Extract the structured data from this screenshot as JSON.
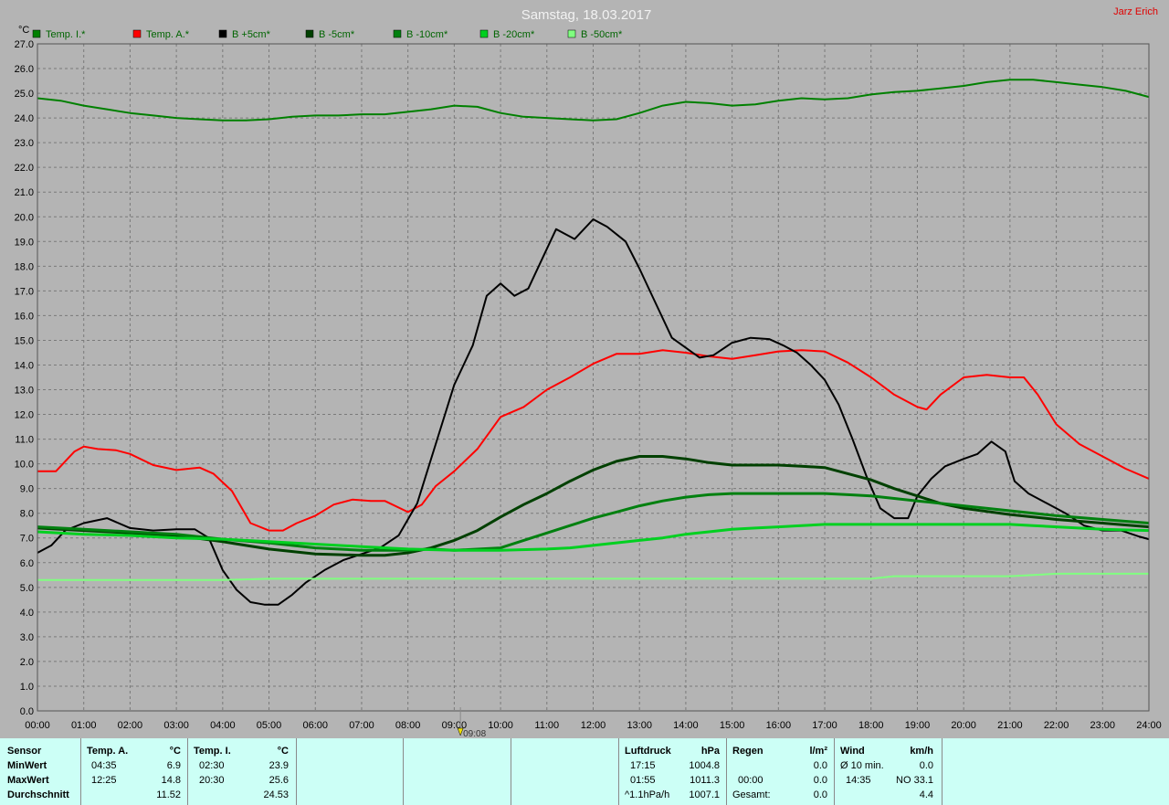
{
  "title": "Samstag, 18.03.2017",
  "author": "Jarz Erich",
  "y_unit": "°C",
  "current_time": "09:08",
  "colors": {
    "background": "#b4b4b4",
    "grid": "#7a7a7a",
    "title": "#f2f2f2",
    "author": "#e00000",
    "legend_text": "#006400",
    "panel": "#ccfff6"
  },
  "chart_data": {
    "type": "line",
    "title": "Samstag, 18.03.2017",
    "ylabel": "°C",
    "ylim": [
      0,
      27
    ],
    "xlim": [
      0,
      24
    ],
    "grid": true,
    "legend_position": "top",
    "x_ticks": [
      "00:00",
      "01:00",
      "02:00",
      "03:00",
      "04:00",
      "05:00",
      "06:00",
      "07:00",
      "08:00",
      "09:00",
      "10:00",
      "11:00",
      "12:00",
      "13:00",
      "14:00",
      "15:00",
      "16:00",
      "17:00",
      "18:00",
      "19:00",
      "20:00",
      "21:00",
      "22:00",
      "23:00",
      "24:00"
    ],
    "y_ticks": [
      "0.0",
      "1.0",
      "2.0",
      "3.0",
      "4.0",
      "5.0",
      "6.0",
      "7.0",
      "8.0",
      "9.0",
      "10.0",
      "11.0",
      "12.0",
      "13.0",
      "14.0",
      "15.0",
      "16.0",
      "17.0",
      "18.0",
      "19.0",
      "20.0",
      "21.0",
      "22.0",
      "23.0",
      "24.0",
      "25.0",
      "26.0",
      "27.0"
    ],
    "series": [
      {
        "name": "Temp. I.*",
        "color": "#008000",
        "width": 2,
        "x": [
          0,
          0.5,
          1,
          1.5,
          2,
          2.5,
          3,
          3.5,
          4,
          4.5,
          5,
          5.5,
          6,
          6.5,
          7,
          7.5,
          8,
          8.5,
          9,
          9.5,
          10,
          10.5,
          11,
          11.5,
          12,
          12.5,
          13,
          13.5,
          14,
          14.5,
          15,
          15.5,
          16,
          16.5,
          17,
          17.5,
          18,
          18.5,
          19,
          19.5,
          20,
          20.5,
          21,
          21.5,
          22,
          22.5,
          23,
          23.5,
          24
        ],
        "y": [
          24.8,
          24.7,
          24.5,
          24.35,
          24.2,
          24.1,
          24.0,
          23.95,
          23.9,
          23.9,
          23.95,
          24.05,
          24.1,
          24.1,
          24.15,
          24.15,
          24.25,
          24.35,
          24.5,
          24.45,
          24.2,
          24.05,
          24.0,
          23.95,
          23.9,
          23.95,
          24.2,
          24.5,
          24.65,
          24.6,
          24.5,
          24.55,
          24.7,
          24.8,
          24.75,
          24.8,
          24.95,
          25.05,
          25.1,
          25.2,
          25.3,
          25.45,
          25.55,
          25.55,
          25.45,
          25.35,
          25.25,
          25.1,
          24.85
        ]
      },
      {
        "name": "Temp. A.*",
        "color": "#ff0000",
        "width": 2,
        "x": [
          0,
          0.4,
          0.8,
          1.0,
          1.3,
          1.7,
          2.0,
          2.5,
          3.0,
          3.5,
          3.8,
          4.2,
          4.6,
          5.0,
          5.3,
          5.6,
          6.0,
          6.4,
          6.8,
          7.2,
          7.5,
          8.0,
          8.3,
          8.6,
          9.0,
          9.5,
          10.0,
          10.5,
          11.0,
          11.5,
          12.0,
          12.5,
          13.0,
          13.5,
          14.0,
          14.5,
          15.0,
          15.5,
          16.0,
          16.5,
          17.0,
          17.5,
          18.0,
          18.5,
          19.0,
          19.2,
          19.5,
          20.0,
          20.5,
          21.0,
          21.3,
          21.6,
          22.0,
          22.5,
          23.0,
          23.5,
          24.0
        ],
        "y": [
          9.7,
          9.7,
          10.5,
          10.7,
          10.6,
          10.55,
          10.4,
          9.95,
          9.75,
          9.85,
          9.6,
          8.9,
          7.6,
          7.3,
          7.3,
          7.6,
          7.9,
          8.35,
          8.55,
          8.5,
          8.5,
          8.05,
          8.35,
          9.1,
          9.7,
          10.6,
          11.9,
          12.3,
          13.0,
          13.5,
          14.05,
          14.45,
          14.45,
          14.6,
          14.5,
          14.35,
          14.25,
          14.4,
          14.55,
          14.6,
          14.55,
          14.1,
          13.5,
          12.8,
          12.3,
          12.2,
          12.8,
          13.5,
          13.6,
          13.5,
          13.5,
          12.8,
          11.6,
          10.8,
          10.3,
          9.8,
          9.4
        ]
      },
      {
        "name": "B +5cm*",
        "color": "#000000",
        "width": 2,
        "x": [
          0,
          0.3,
          0.6,
          1.0,
          1.5,
          2.0,
          2.5,
          3.0,
          3.4,
          3.7,
          4.0,
          4.3,
          4.6,
          4.9,
          5.2,
          5.5,
          5.8,
          6.2,
          6.6,
          7.0,
          7.4,
          7.8,
          8.2,
          8.6,
          9.0,
          9.4,
          9.7,
          10.0,
          10.3,
          10.6,
          10.9,
          11.2,
          11.6,
          12.0,
          12.3,
          12.7,
          13.0,
          13.3,
          13.7,
          14.0,
          14.3,
          14.6,
          15.0,
          15.4,
          15.8,
          16.1,
          16.4,
          16.7,
          17.0,
          17.3,
          17.6,
          17.9,
          18.2,
          18.5,
          18.8,
          19.0,
          19.3,
          19.6,
          20.0,
          20.3,
          20.6,
          20.9,
          21.1,
          21.4,
          21.8,
          22.2,
          22.6,
          23.0,
          23.4,
          23.8,
          24.0
        ],
        "y": [
          6.4,
          6.7,
          7.3,
          7.6,
          7.8,
          7.4,
          7.3,
          7.35,
          7.35,
          7.0,
          5.7,
          4.9,
          4.4,
          4.3,
          4.3,
          4.7,
          5.2,
          5.7,
          6.1,
          6.35,
          6.6,
          7.1,
          8.4,
          10.8,
          13.2,
          14.8,
          16.8,
          17.3,
          16.8,
          17.1,
          18.3,
          19.5,
          19.1,
          19.9,
          19.6,
          19.0,
          17.9,
          16.7,
          15.1,
          14.7,
          14.3,
          14.4,
          14.9,
          15.1,
          15.05,
          14.8,
          14.5,
          14.0,
          13.4,
          12.4,
          11.0,
          9.5,
          8.2,
          7.8,
          7.8,
          8.7,
          9.4,
          9.9,
          10.2,
          10.4,
          10.9,
          10.5,
          9.3,
          8.8,
          8.4,
          8.0,
          7.5,
          7.3,
          7.3,
          7.05,
          6.95
        ]
      },
      {
        "name": "B -5cm*",
        "color": "#004000",
        "width": 3,
        "x": [
          0,
          1,
          2,
          3,
          4,
          5,
          6,
          7,
          7.5,
          8,
          8.5,
          9,
          9.5,
          10,
          10.5,
          11,
          11.5,
          12,
          12.5,
          13,
          13.5,
          14,
          14.5,
          15,
          15.5,
          16,
          16.5,
          17,
          17.5,
          18,
          18.5,
          19,
          19.5,
          20,
          21,
          22,
          23,
          24
        ],
        "y": [
          7.4,
          7.3,
          7.2,
          7.1,
          6.85,
          6.55,
          6.35,
          6.3,
          6.3,
          6.4,
          6.6,
          6.9,
          7.3,
          7.85,
          8.35,
          8.8,
          9.3,
          9.75,
          10.1,
          10.3,
          10.3,
          10.2,
          10.05,
          9.95,
          9.95,
          9.95,
          9.9,
          9.85,
          9.6,
          9.35,
          9.0,
          8.7,
          8.4,
          8.2,
          7.95,
          7.75,
          7.6,
          7.45
        ]
      },
      {
        "name": "B -10cm*",
        "color": "#00800f",
        "width": 3,
        "x": [
          0,
          1,
          2,
          3,
          4,
          5,
          6,
          7,
          8,
          8.5,
          9,
          10,
          10.5,
          11,
          11.5,
          12,
          12.5,
          13,
          13.5,
          14,
          14.5,
          15,
          15.5,
          16,
          17,
          17.5,
          18,
          18.5,
          19,
          19.5,
          20,
          21,
          22,
          23,
          24
        ],
        "y": [
          7.45,
          7.35,
          7.25,
          7.15,
          6.95,
          6.8,
          6.6,
          6.5,
          6.5,
          6.55,
          6.5,
          6.6,
          6.9,
          7.2,
          7.5,
          7.8,
          8.05,
          8.3,
          8.5,
          8.65,
          8.75,
          8.8,
          8.8,
          8.8,
          8.8,
          8.75,
          8.7,
          8.6,
          8.5,
          8.4,
          8.3,
          8.1,
          7.9,
          7.75,
          7.6
        ]
      },
      {
        "name": "B -20cm*",
        "color": "#00d020",
        "width": 3,
        "x": [
          0,
          1,
          2,
          3,
          4,
          5,
          6,
          7,
          8,
          9,
          10,
          11,
          11.5,
          12,
          12.5,
          13,
          13.5,
          14,
          14.5,
          15,
          15.5,
          16,
          16.5,
          17,
          18,
          19,
          20,
          21,
          21.5,
          22,
          23,
          24
        ],
        "y": [
          7.25,
          7.15,
          7.1,
          7.0,
          6.95,
          6.85,
          6.75,
          6.65,
          6.55,
          6.5,
          6.5,
          6.55,
          6.6,
          6.7,
          6.8,
          6.9,
          7.0,
          7.15,
          7.25,
          7.35,
          7.4,
          7.45,
          7.5,
          7.55,
          7.55,
          7.55,
          7.55,
          7.55,
          7.5,
          7.45,
          7.35,
          7.3
        ]
      },
      {
        "name": "B -50cm*",
        "color": "#80ff80",
        "width": 2,
        "x": [
          0,
          4,
          5,
          18,
          18.5,
          19,
          21,
          22,
          23,
          24
        ],
        "y": [
          5.3,
          5.3,
          5.35,
          5.35,
          5.45,
          5.45,
          5.45,
          5.55,
          5.55,
          5.55
        ]
      }
    ]
  },
  "stats": {
    "sensor_label": "Sensor",
    "min_label": "MinWert",
    "max_label": "MaxWert",
    "avg_label": "Durchschnitt",
    "temp_a": {
      "title": "Temp. A.",
      "unit": "°C",
      "min_time": "04:35",
      "min_val": "6.9",
      "max_time": "12:25",
      "max_val": "14.8",
      "avg": "11.52"
    },
    "temp_i": {
      "title": "Temp. I.",
      "unit": "°C",
      "min_time": "02:30",
      "min_val": "23.9",
      "max_time": "20:30",
      "max_val": "25.6",
      "avg": "24.53"
    },
    "pressure": {
      "title": "Luftdruck",
      "unit": "hPa",
      "min_time": "17:15",
      "min_val": "1004.8",
      "max_time": "01:55",
      "max_val": "1011.3",
      "trend": "^1.1hPa/h",
      "current": "1007.1"
    },
    "rain": {
      "title": "Regen",
      "unit": "l/m²",
      "r2_time": "00:00",
      "r2_val": "0.0",
      "total_label": "Gesamt:",
      "total_val": "0.0",
      "r1_val": "0.0"
    },
    "wind": {
      "title": "Wind",
      "unit": "km/h",
      "avg10_label": "Ø 10 min.",
      "avg10_val": "0.0",
      "gust_time": "14:35",
      "gust_val": "NO 33.1",
      "avg": "4.4"
    }
  }
}
